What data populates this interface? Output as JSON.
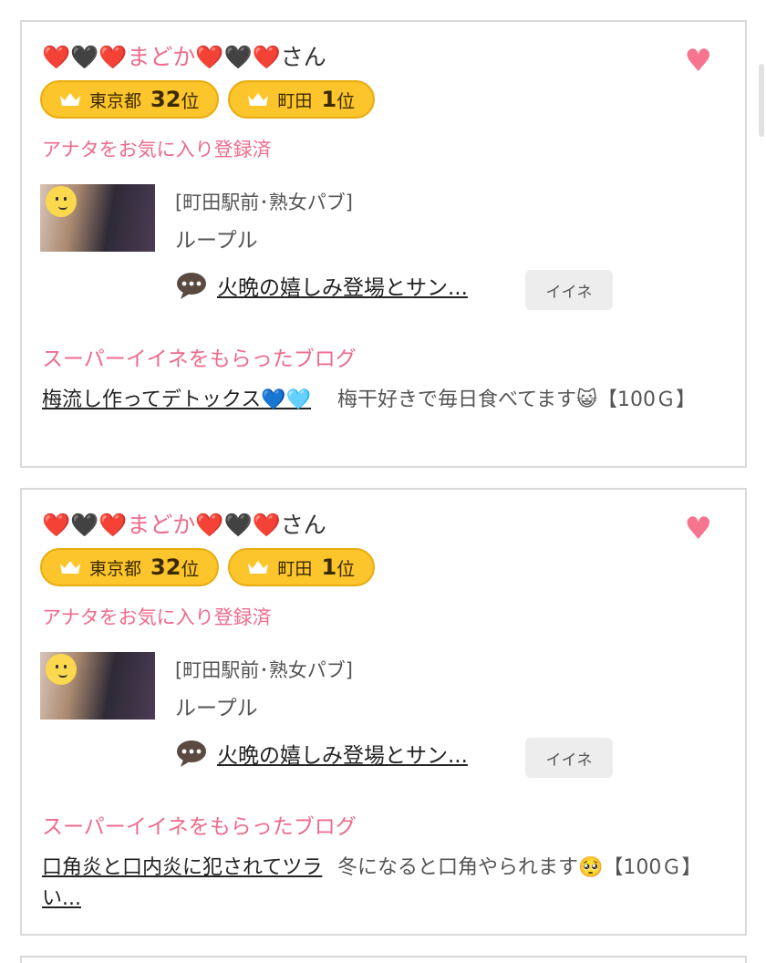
{
  "cards": [
    {
      "name_prefix": "❤️🖤❤️",
      "name_text": "まどか",
      "name_suffix": "❤️🖤❤️",
      "name_honorific": "さん",
      "fav_heart": "♥",
      "badges": [
        {
          "label": "東京都",
          "rank": "32",
          "suffix": "位"
        },
        {
          "label": "町田",
          "rank": "1",
          "suffix": "位"
        }
      ],
      "fav_status": "アナタをお気に入り登録済",
      "shop_category": "[町田駅前･熟女パブ]",
      "shop_name": "ループル",
      "blog_title": "火晩の嬉しみ登場とサン...",
      "like_label": "イイネ",
      "super_heading": "スーパーイイネをもらったブログ",
      "super_blog_title": "梅流し作ってデトックス💙🩵",
      "super_blog_desc": "梅干好きで毎日食べてます😺【100Ｇ】"
    },
    {
      "name_prefix": "❤️🖤❤️",
      "name_text": "まどか",
      "name_suffix": "❤️🖤❤️",
      "name_honorific": "さん",
      "fav_heart": "♥",
      "badges": [
        {
          "label": "東京都",
          "rank": "32",
          "suffix": "位"
        },
        {
          "label": "町田",
          "rank": "1",
          "suffix": "位"
        }
      ],
      "fav_status": "アナタをお気に入り登録済",
      "shop_category": "[町田駅前･熟女パブ]",
      "shop_name": "ループル",
      "blog_title": "火晩の嬉しみ登場とサン...",
      "like_label": "イイネ",
      "super_heading": "スーパーイイネをもらったブログ",
      "super_blog_title": "口角炎と口内炎に犯されてツラい...",
      "super_blog_desc": "冬になると口角やられます🥺【100Ｇ】"
    }
  ],
  "icons": {
    "crown": "crown-icon",
    "chat": "chat-bubble-icon",
    "heart": "heart-icon",
    "avatar_sticker": "smiley-sticker-icon"
  },
  "colors": {
    "accent_pink": "#ee6b8c",
    "heart_pink": "#f7748e",
    "badge_gold": "#fcc52b",
    "card_border": "#d9d9d9"
  }
}
